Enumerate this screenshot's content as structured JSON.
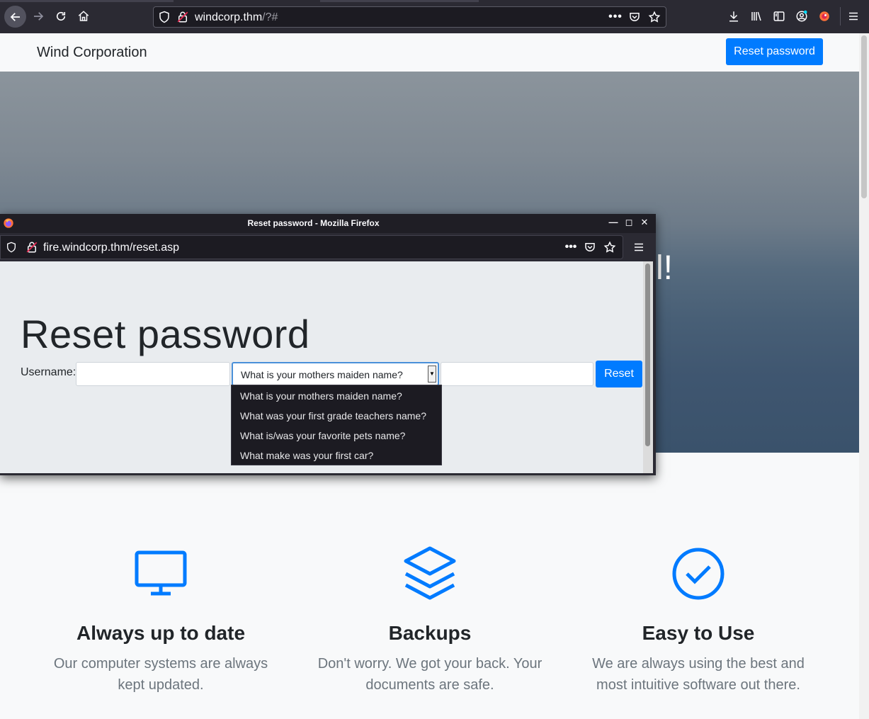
{
  "browser": {
    "url_host": "windcorp.thm",
    "url_rest": "/?#"
  },
  "page": {
    "brand": "Wind Corporation",
    "reset_button": "Reset password",
    "hero_text": "l!",
    "features": [
      {
        "icon": "monitor-icon",
        "title": "Always up to date",
        "text_line1": "Our computer systems are always",
        "text_line2": "kept updated."
      },
      {
        "icon": "layers-icon",
        "title": "Backups",
        "text_line1": "Don't worry. We got your back. Your",
        "text_line2": "documents are safe."
      },
      {
        "icon": "check-circle-icon",
        "title": "Easy to Use",
        "text_line1": "We are always using the best and",
        "text_line2": "most intuitive software out there."
      }
    ]
  },
  "popup": {
    "window_title": "Reset password - Mozilla Firefox",
    "url": "fire.windcorp.thm/reset.asp",
    "heading": "Reset password",
    "username_label": "Username:",
    "selected_question": "What is your mothers maiden name?",
    "options": [
      "What is your mothers maiden name?",
      "What was your first grade teachers name?",
      "What is/was your favorite pets name?",
      "What make was your first car?"
    ],
    "submit_label": "Reset"
  },
  "colors": {
    "accent": "#007bff",
    "chrome": "#2b2a33"
  }
}
